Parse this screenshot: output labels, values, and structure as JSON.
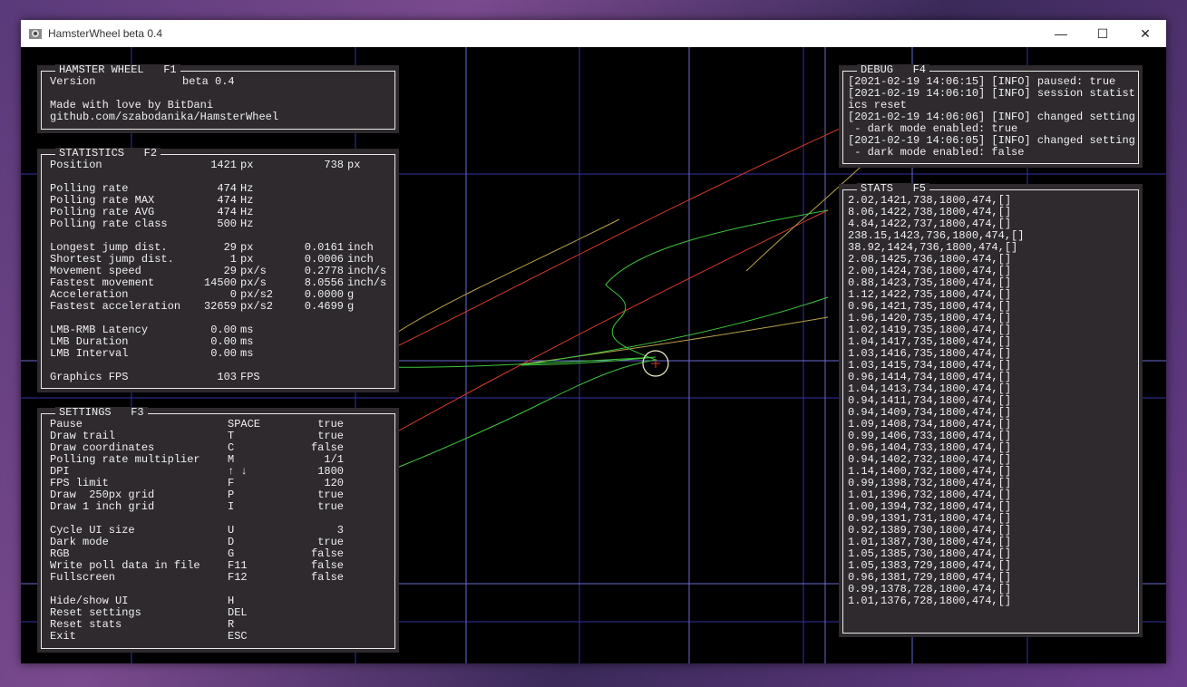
{
  "window": {
    "title": "HamsterWheel beta 0.4",
    "minimize": "—",
    "maximize": "☐",
    "close": "✕"
  },
  "hamster": {
    "title": "HAMSTER WHEEL   F1",
    "version_label": "Version",
    "version_value": "beta 0.4",
    "made_by": "Made with love by BitDani",
    "github": "github.com/szabodanika/HamsterWheel"
  },
  "statistics": {
    "title": "STATISTICS   F2",
    "position": {
      "label": "Position",
      "x": "1421",
      "x_unit": "px",
      "y": "738",
      "y_unit": "px"
    },
    "rows": [
      {
        "label": "Polling rate",
        "v1": "474",
        "u1": "Hz",
        "v2": "",
        "u2": ""
      },
      {
        "label": "Polling rate MAX",
        "v1": "474",
        "u1": "Hz",
        "v2": "",
        "u2": ""
      },
      {
        "label": "Polling rate AVG",
        "v1": "474",
        "u1": "Hz",
        "v2": "",
        "u2": ""
      },
      {
        "label": "Polling rate class",
        "v1": "500",
        "u1": "Hz",
        "v2": "",
        "u2": ""
      },
      {
        "label": "",
        "v1": "",
        "u1": "",
        "v2": "",
        "u2": ""
      },
      {
        "label": "Longest jump dist.",
        "v1": "29",
        "u1": "px",
        "v2": "0.0161",
        "u2": "inch"
      },
      {
        "label": "Shortest jump dist.",
        "v1": "1",
        "u1": "px",
        "v2": "0.0006",
        "u2": "inch"
      },
      {
        "label": "Movement speed",
        "v1": "29",
        "u1": "px/s",
        "v2": "0.2778",
        "u2": "inch/s"
      },
      {
        "label": "Fastest movement",
        "v1": "14500",
        "u1": "px/s",
        "v2": "8.0556",
        "u2": "inch/s"
      },
      {
        "label": "Acceleration",
        "v1": "0",
        "u1": "px/s2",
        "v2": "0.0000",
        "u2": "g"
      },
      {
        "label": "Fastest acceleration",
        "v1": "32659",
        "u1": "px/s2",
        "v2": "0.4699",
        "u2": "g"
      },
      {
        "label": "",
        "v1": "",
        "u1": "",
        "v2": "",
        "u2": ""
      },
      {
        "label": "LMB-RMB Latency",
        "v1": "0.00",
        "u1": "ms",
        "v2": "",
        "u2": ""
      },
      {
        "label": "LMB Duration",
        "v1": "0.00",
        "u1": "ms",
        "v2": "",
        "u2": ""
      },
      {
        "label": "LMB Interval",
        "v1": "0.00",
        "u1": "ms",
        "v2": "",
        "u2": ""
      },
      {
        "label": "",
        "v1": "",
        "u1": "",
        "v2": "",
        "u2": ""
      },
      {
        "label": "Graphics FPS",
        "v1": "103",
        "u1": "FPS",
        "v2": "",
        "u2": ""
      }
    ]
  },
  "settings": {
    "title": "SETTINGS   F3",
    "rows": [
      {
        "label": "Pause",
        "key": "SPACE",
        "value": "true"
      },
      {
        "label": "Draw trail",
        "key": "T",
        "value": "true"
      },
      {
        "label": "Draw coordinates",
        "key": "C",
        "value": "false"
      },
      {
        "label": "Polling rate multiplier",
        "key": "M",
        "value": "1/1"
      },
      {
        "label": "DPI",
        "key": "↑ ↓",
        "value": "1800"
      },
      {
        "label": "FPS limit",
        "key": "F",
        "value": "120"
      },
      {
        "label": "Draw  250px grid",
        "key": "P",
        "value": "true"
      },
      {
        "label": "Draw 1 inch grid",
        "key": "I",
        "value": "true"
      },
      {
        "label": "",
        "key": "",
        "value": ""
      },
      {
        "label": "Cycle UI size",
        "key": "U",
        "value": "3"
      },
      {
        "label": "Dark mode",
        "key": "D",
        "value": "true"
      },
      {
        "label": "RGB",
        "key": "G",
        "value": "false"
      },
      {
        "label": "Write poll data in file",
        "key": "F11",
        "value": "false"
      },
      {
        "label": "Fullscreen",
        "key": "F12",
        "value": "false"
      },
      {
        "label": "",
        "key": "",
        "value": ""
      },
      {
        "label": "Hide/show UI",
        "key": "H",
        "value": ""
      },
      {
        "label": "Reset settings",
        "key": "DEL",
        "value": ""
      },
      {
        "label": "Reset stats",
        "key": "R",
        "value": ""
      },
      {
        "label": "Exit",
        "key": "ESC",
        "value": ""
      }
    ]
  },
  "debug": {
    "title": "DEBUG   F4",
    "lines": [
      "[2021-02-19 14:06:15] [INFO] paused: true",
      "[2021-02-19 14:06:10] [INFO] session statist",
      "ics reset",
      "[2021-02-19 14:06:06] [INFO] changed setting",
      " - dark mode enabled: true",
      "[2021-02-19 14:06:05] [INFO] changed setting",
      " - dark mode enabled: false"
    ]
  },
  "stats": {
    "title": "STATS   F5",
    "lines": [
      "2.02,1421,738,1800,474,[]",
      "8.06,1422,738,1800,474,[]",
      "4.84,1422,737,1800,474,[]",
      "238.15,1423,736,1800,474,[]",
      "38.92,1424,736,1800,474,[]",
      "2.08,1425,736,1800,474,[]",
      "2.00,1424,736,1800,474,[]",
      "0.88,1423,735,1800,474,[]",
      "1.12,1422,735,1800,474,[]",
      "0.96,1421,735,1800,474,[]",
      "1.96,1420,735,1800,474,[]",
      "1.02,1419,735,1800,474,[]",
      "1.04,1417,735,1800,474,[]",
      "1.03,1416,735,1800,474,[]",
      "1.03,1415,734,1800,474,[]",
      "0.96,1414,734,1800,474,[]",
      "1.04,1413,734,1800,474,[]",
      "0.94,1411,734,1800,474,[]",
      "0.94,1409,734,1800,474,[]",
      "1.09,1408,734,1800,474,[]",
      "0.99,1406,733,1800,474,[]",
      "0.96,1404,733,1800,474,[]",
      "0.94,1402,732,1800,474,[]",
      "1.14,1400,732,1800,474,[]",
      "0.99,1398,732,1800,474,[]",
      "1.01,1396,732,1800,474,[]",
      "1.00,1394,732,1800,474,[]",
      "0.99,1391,731,1800,474,[]",
      "0.92,1389,730,1800,474,[]",
      "1.01,1387,730,1800,474,[]",
      "1.05,1385,730,1800,474,[]",
      "1.05,1383,729,1800,474,[]",
      "0.96,1381,729,1800,474,[]",
      "0.99,1378,728,1800,474,[]",
      "1.01,1376,728,1800,474,[]"
    ]
  },
  "colors": {
    "grid_250px": "#2a2aa0",
    "grid_inch": "#6a6ad0",
    "trail_green": "#3ec43e",
    "trail_red": "#d43a2a",
    "trail_yellow": "#b8a24a",
    "panel_bg": "#2e2a2e",
    "cursor_ring": "#f2f2c8"
  }
}
